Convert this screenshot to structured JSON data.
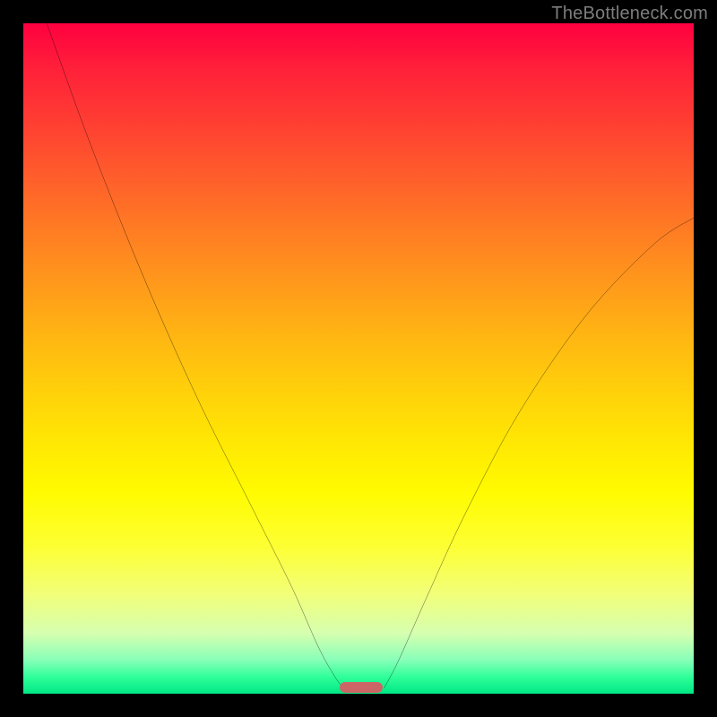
{
  "watermark": {
    "text": "TheBottleneck.com"
  },
  "chart_data": {
    "type": "line",
    "title": "",
    "xlabel": "",
    "ylabel": "",
    "xlim": [
      0,
      100
    ],
    "ylim": [
      0,
      100
    ],
    "gradient_bands": [
      {
        "y_pct": 0,
        "color": "#ff0040"
      },
      {
        "y_pct": 25,
        "color": "#ff6b28"
      },
      {
        "y_pct": 50,
        "color": "#ffc90e"
      },
      {
        "y_pct": 75,
        "color": "#fffb00"
      },
      {
        "y_pct": 92,
        "color": "#d6ffb0"
      },
      {
        "y_pct": 100,
        "color": "#00e884"
      }
    ],
    "series": [
      {
        "name": "left_arm",
        "x": [
          3.5,
          10.0,
          18.0,
          26.0,
          34.0,
          40.0,
          44.0,
          46.5,
          47.8
        ],
        "value": [
          100.0,
          82.0,
          62.0,
          44.0,
          28.0,
          16.0,
          7.0,
          2.5,
          0.8
        ]
      },
      {
        "name": "right_arm",
        "x": [
          53.8,
          56.0,
          60.0,
          66.0,
          74.0,
          84.0,
          94.0,
          100.0
        ],
        "value": [
          0.8,
          5.0,
          14.0,
          27.0,
          42.0,
          56.5,
          67.0,
          71.0
        ]
      }
    ],
    "marker": {
      "name": "bottleneck-marker",
      "x_pct": 50.4,
      "width_pct": 6.4,
      "color": "#cc6666"
    }
  }
}
